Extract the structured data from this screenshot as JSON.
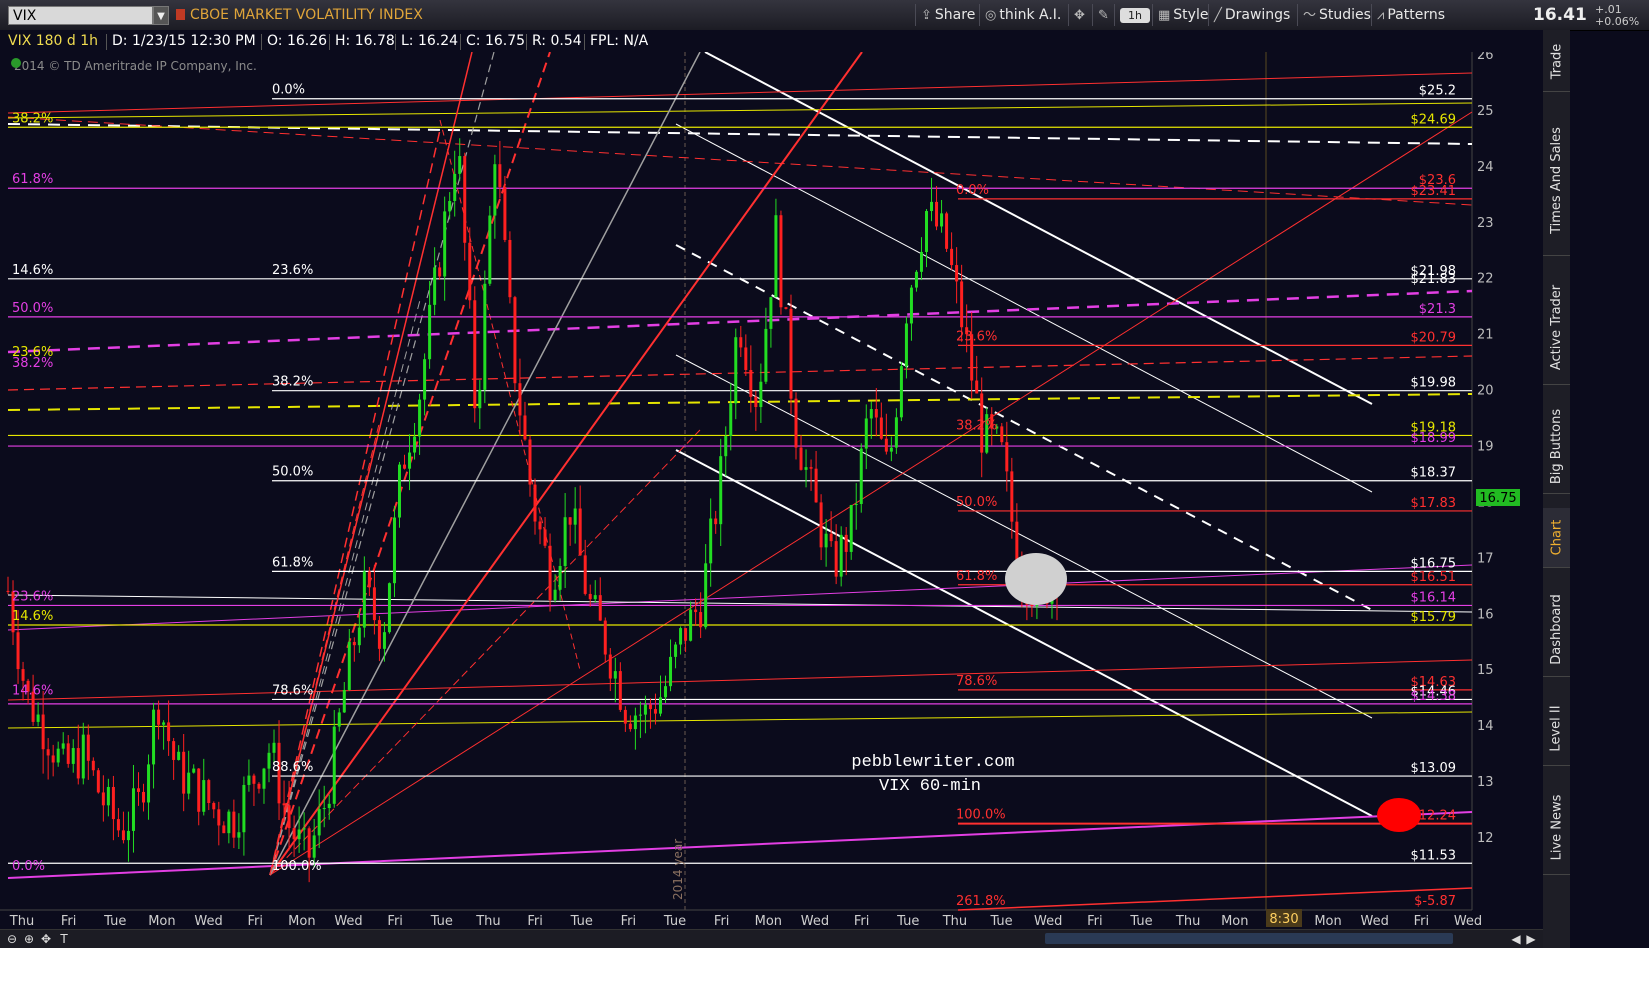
{
  "toolbar": {
    "symbol": "VIX",
    "company": "CBOE MARKET VOLATILITY INDEX",
    "buttons": {
      "share": "Share",
      "think_ai": "think A.I.",
      "interval": "1h",
      "style": "Style",
      "drawings": "Drawings",
      "studies": "Studies",
      "patterns": "Patterns"
    },
    "last_price": "16.41",
    "change_a": "+.01",
    "change_b": "+0.06%"
  },
  "infobar": {
    "name": "VIX 180 d 1h",
    "date": "D: 1/23/15 12:30 PM",
    "open": "O: 16.26",
    "high": "H: 16.78",
    "low": "L: 16.24",
    "close": "C: 16.75",
    "range": "R: 0.54",
    "fpl": "FPL: N/A"
  },
  "side_tabs": [
    "Trade",
    "Times And Sales",
    "Active Trader",
    "Big Buttons",
    "Chart",
    "Dashboard",
    "Level II",
    "Live News"
  ],
  "colors": {
    "background": "#0b0b1c",
    "fib_white": "#ffffff",
    "fib_magenta": "#e33fe3",
    "fib_yellow": "#e6e600",
    "fib_red": "#ff2a2a",
    "candle_up": "#22dd22",
    "candle_down": "#ff2020"
  },
  "chart_data": {
    "type": "candlestick",
    "title": "",
    "symbol": "VIX",
    "description": "CBOE MARKET VOLATILITY INDEX",
    "aggregation": "60-min",
    "watermark": [
      "pebblewriter.com",
      "VIX 60-min"
    ],
    "copyright": "2014 © TD Ameritrade IP Company, Inc.",
    "year_marker": "2014 year",
    "current_price_tag": "16.75",
    "time_marker": "8:30",
    "ylim": [
      11.3,
      26.2
    ],
    "y_ticks": [
      12,
      13,
      14,
      15,
      16,
      17,
      18,
      19,
      20,
      21,
      22,
      23,
      24,
      25,
      26
    ],
    "x_tick_labels": [
      "Thu",
      "Fri",
      "Tue",
      "Mon",
      "Wed",
      "Fri",
      "Mon",
      "Wed",
      "Fri",
      "Tue",
      "Thu",
      "Fri",
      "Tue",
      "Fri",
      "Tue",
      "Fri",
      "Mon",
      "Wed",
      "Fri",
      "Tue",
      "Thu",
      "Tue",
      "Wed",
      "Fri",
      "Tue",
      "Thu",
      "Mon",
      "Wed",
      "Mon",
      "Wed",
      "Fri",
      "Wed"
    ],
    "price_levels": [
      {
        "label": "$25.2",
        "value": 25.2,
        "color": "#ffffff"
      },
      {
        "label": "$24.69",
        "value": 24.69,
        "color": "#e6e600"
      },
      {
        "label": "$23.6",
        "value": 23.6,
        "color": "#ff3030"
      },
      {
        "label": "$23.41",
        "value": 23.41,
        "color": "#ff3030"
      },
      {
        "label": "$21.98",
        "value": 21.98,
        "color": "#ffffff"
      },
      {
        "label": "$21.83",
        "value": 21.83,
        "color": "#ffffff"
      },
      {
        "label": "$21.3",
        "value": 21.3,
        "color": "#e33fe3"
      },
      {
        "label": "$20.79",
        "value": 20.79,
        "color": "#ff3030"
      },
      {
        "label": "$19.98",
        "value": 19.98,
        "color": "#ffffff"
      },
      {
        "label": "$19.18",
        "value": 19.18,
        "color": "#e6e600"
      },
      {
        "label": "$18.99",
        "value": 18.99,
        "color": "#e33fe3"
      },
      {
        "label": "$18.37",
        "value": 18.37,
        "color": "#ffffff"
      },
      {
        "label": "$17.83",
        "value": 17.83,
        "color": "#ff3030"
      },
      {
        "label": "$16.75",
        "value": 16.75,
        "color": "#ffffff"
      },
      {
        "label": "$16.51",
        "value": 16.51,
        "color": "#ff3030"
      },
      {
        "label": "$16.14",
        "value": 16.14,
        "color": "#e33fe3"
      },
      {
        "label": "$15.79",
        "value": 15.79,
        "color": "#e6e600"
      },
      {
        "label": "$14.63",
        "value": 14.63,
        "color": "#ff3030"
      },
      {
        "label": "$14.46",
        "value": 14.46,
        "color": "#ffffff"
      },
      {
        "label": "$14.38",
        "value": 14.38,
        "color": "#e33fe3"
      },
      {
        "label": "$13.09",
        "value": 13.09,
        "color": "#ffffff"
      },
      {
        "label": "$12.24",
        "value": 12.24,
        "color": "#ff3030"
      },
      {
        "label": "$11.53",
        "value": 11.53,
        "color": "#ffffff"
      },
      {
        "label": "$-5.87",
        "value": 11.3,
        "color": "#ff3030"
      }
    ],
    "fib_labels": [
      {
        "text": "0.0%",
        "value": 25.2,
        "color": "#ffffff",
        "group": "white"
      },
      {
        "text": "23.6%",
        "value": 21.98,
        "color": "#ffffff",
        "group": "white"
      },
      {
        "text": "38.2%",
        "value": 19.98,
        "color": "#ffffff",
        "group": "white"
      },
      {
        "text": "50.0%",
        "value": 18.37,
        "color": "#ffffff",
        "group": "white"
      },
      {
        "text": "61.8%",
        "value": 16.75,
        "color": "#ffffff",
        "group": "white"
      },
      {
        "text": "78.6%",
        "value": 14.46,
        "color": "#ffffff",
        "group": "white"
      },
      {
        "text": "88.6%",
        "value": 13.09,
        "color": "#ffffff",
        "group": "white"
      },
      {
        "text": "100.0%",
        "value": 11.53,
        "color": "#ffffff",
        "group": "white"
      },
      {
        "text": "38.2%",
        "value": 24.69,
        "color": "#e6e600",
        "group": "yellow"
      },
      {
        "text": "23.6%",
        "value": 19.18,
        "color": "#e6e600",
        "group": "yellow"
      },
      {
        "text": "14.6%",
        "value": 15.79,
        "color": "#e6e600",
        "group": "yellow"
      },
      {
        "text": "14.6%",
        "value": 21.98,
        "color": "#ffffff",
        "group": "white-left"
      },
      {
        "text": "61.8%",
        "value": 23.6,
        "color": "#e33fe3",
        "group": "magenta"
      },
      {
        "text": "50.0%",
        "value": 21.3,
        "color": "#e33fe3",
        "group": "magenta"
      },
      {
        "text": "38.2%",
        "value": 18.99,
        "color": "#e33fe3",
        "group": "magenta"
      },
      {
        "text": "23.6%",
        "value": 16.14,
        "color": "#e33fe3",
        "group": "magenta"
      },
      {
        "text": "14.6%",
        "value": 14.46,
        "color": "#e33fe3",
        "group": "magenta"
      },
      {
        "text": "0.0%",
        "value": 11.45,
        "color": "#e33fe3",
        "group": "magenta"
      },
      {
        "text": "0.0%",
        "value": 23.41,
        "color": "#ff3030",
        "group": "red"
      },
      {
        "text": "23.6%",
        "value": 20.79,
        "color": "#ff3030",
        "group": "red"
      },
      {
        "text": "38.2%",
        "value": 19.2,
        "color": "#ff3030",
        "group": "red"
      },
      {
        "text": "50.0%",
        "value": 17.83,
        "color": "#ff3030",
        "group": "red"
      },
      {
        "text": "61.8%",
        "value": 16.51,
        "color": "#ff3030",
        "group": "red"
      },
      {
        "text": "78.6%",
        "value": 14.63,
        "color": "#ff3030",
        "group": "red"
      },
      {
        "text": "100.0%",
        "value": 12.24,
        "color": "#ff3030",
        "group": "red"
      },
      {
        "text": "261.8%",
        "value": 11.3,
        "color": "#ff3030",
        "group": "red"
      }
    ],
    "series": [
      {
        "name": "VIX 1h close (approx.)",
        "values": [
          16.4,
          14.5,
          13.9,
          13.2,
          13.5,
          12.7,
          12.1,
          12.6,
          14.5,
          13.2,
          12.9,
          12.5,
          12.3,
          13.0,
          13.6,
          12.2,
          11.6,
          12.7,
          14.7,
          16.4,
          15.6,
          18.6,
          20.0,
          22.3,
          24.5,
          19.4,
          24.4,
          20.5,
          18.0,
          16.6,
          17.9,
          16.2,
          15.4,
          14.3,
          14.2,
          14.6,
          15.6,
          16.2,
          18.3,
          21.3,
          19.8,
          22.8,
          19.4,
          18.0,
          16.8,
          17.5,
          19.7,
          18.5,
          21.6,
          23.2,
          22.7,
          21.1,
          19.2,
          18.9,
          16.8,
          16.3,
          16.75
        ]
      }
    ]
  }
}
